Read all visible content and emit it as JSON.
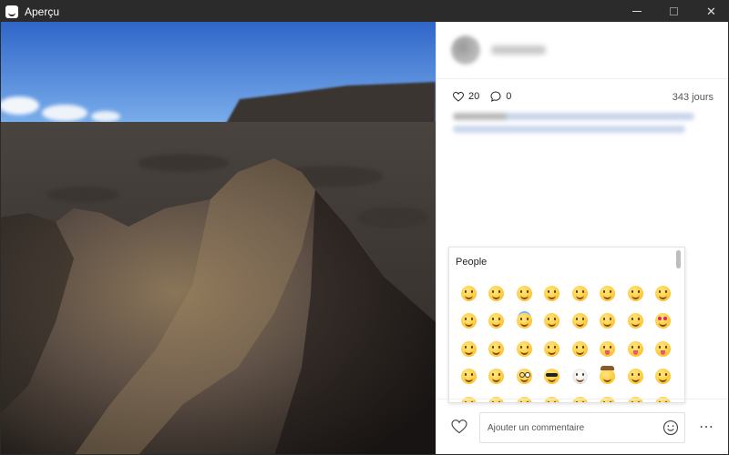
{
  "window": {
    "title": "Aperçu",
    "close_glyph": "✕"
  },
  "post": {
    "likes": "20",
    "comments": "0",
    "age": "343 jours"
  },
  "emoji_picker": {
    "category": "People",
    "emojis": [
      "grinning",
      "smiley",
      "smile",
      "grin",
      "laughing",
      "sweat-smile",
      "joy",
      "rofl",
      "relaxed",
      "blush",
      "innocent",
      "slight-smile",
      "upside-down",
      "wink",
      "relieved",
      "heart-eyes",
      "kissing-heart",
      "kissing",
      "kissing-smiling",
      "kissing-closed-eyes",
      "yum",
      "stuck-out-tongue-winking",
      "stuck-out-tongue-closed",
      "stuck-out-tongue",
      "money-mouth",
      "hugging",
      "nerd",
      "sunglasses",
      "clown",
      "cowboy",
      "smirk",
      "unamused",
      "disappointed",
      "pensive",
      "worried",
      "confused",
      "slight-frown",
      "frowning",
      "persevere",
      "confounded"
    ]
  },
  "comment": {
    "placeholder": "Ajouter un commentaire",
    "more": "⋯"
  }
}
